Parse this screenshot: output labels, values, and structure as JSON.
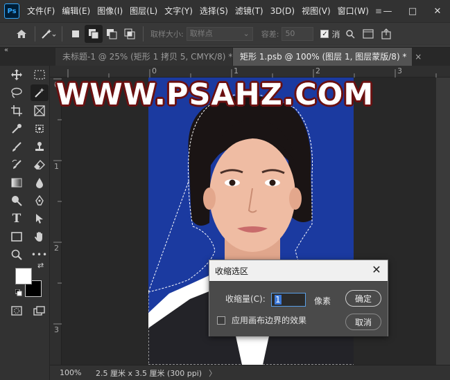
{
  "menubar": {
    "logo": "Ps",
    "items": [
      "文件(F)",
      "编辑(E)",
      "图像(I)",
      "图层(L)",
      "文字(Y)",
      "选择(S)",
      "滤镜(T)",
      "3D(D)",
      "视图(V)",
      "窗口(W)"
    ],
    "more": "≡",
    "controls": {
      "minimize": "—",
      "maximize": "□",
      "close": "✕"
    }
  },
  "options": {
    "home_icon": "home-icon",
    "sample_size_label": "取样大小:",
    "sample_size_value": "取样点",
    "tolerance_label": "容差:",
    "tolerance_value": "50",
    "antialias_label": "消",
    "antialias_checked": true
  },
  "tabs": [
    {
      "label": "未标题-1 @ 25% (矩形 1 拷贝 5, CMYK/8) *",
      "active": false
    },
    {
      "label": "矩形 1.psb @ 100% (图层 1, 图层蒙版/8) *",
      "active": true
    }
  ],
  "toolbar": {
    "collapse": "«",
    "tools": [
      {
        "name": "move-tool-icon",
        "glyph": "✥"
      },
      {
        "name": "marquee-tool-icon",
        "glyph": "⬚"
      },
      {
        "name": "lasso-tool-icon",
        "glyph": "〇"
      },
      {
        "name": "magic-wand-tool-icon",
        "glyph": "⟋"
      },
      {
        "name": "crop-tool-icon",
        "glyph": "⌗"
      },
      {
        "name": "frame-tool-icon",
        "glyph": "⊠"
      },
      {
        "name": "eyedropper-tool-icon",
        "glyph": "✎"
      },
      {
        "name": "spot-healing-tool-icon",
        "glyph": "⊛"
      },
      {
        "name": "brush-tool-icon",
        "glyph": "✐"
      },
      {
        "name": "stamp-tool-icon",
        "glyph": "⊥"
      },
      {
        "name": "history-brush-tool-icon",
        "glyph": "↶"
      },
      {
        "name": "eraser-tool-icon",
        "glyph": "◇"
      },
      {
        "name": "gradient-tool-icon",
        "glyph": "▤"
      },
      {
        "name": "blur-tool-icon",
        "glyph": "●"
      },
      {
        "name": "dodge-tool-icon",
        "glyph": "♦"
      },
      {
        "name": "pen-tool-icon",
        "glyph": "✒"
      },
      {
        "name": "type-tool-icon",
        "glyph": "T"
      },
      {
        "name": "path-selection-tool-icon",
        "glyph": "▶"
      },
      {
        "name": "rectangle-tool-icon",
        "glyph": "▭"
      },
      {
        "name": "hand-tool-icon",
        "glyph": "✋"
      },
      {
        "name": "zoom-tool-icon",
        "glyph": "⚲"
      },
      {
        "name": "more-tools-icon",
        "glyph": "•••"
      }
    ]
  },
  "rulers": {
    "top": [
      "0",
      "1",
      "2",
      "3"
    ],
    "left": [
      "0",
      "1",
      "2",
      "3"
    ]
  },
  "watermark": "WWW.PSAHZ.COM",
  "status": {
    "zoom": "100%",
    "doc_info": "2.5 厘米 x 3.5 厘米 (300 ppi)",
    "arrow": "〉"
  },
  "dialog": {
    "title": "收缩选区",
    "shrink_label": "收缩量(C):",
    "shrink_value": "1",
    "unit": "像素",
    "apply_canvas_label": "应用画布边界的效果",
    "apply_canvas_checked": false,
    "ok": "确定",
    "cancel": "取消"
  },
  "colors": {
    "photo_background": "#1b3aa0",
    "watermark_stroke": "#6b1010",
    "ui_dark": "#323232"
  }
}
